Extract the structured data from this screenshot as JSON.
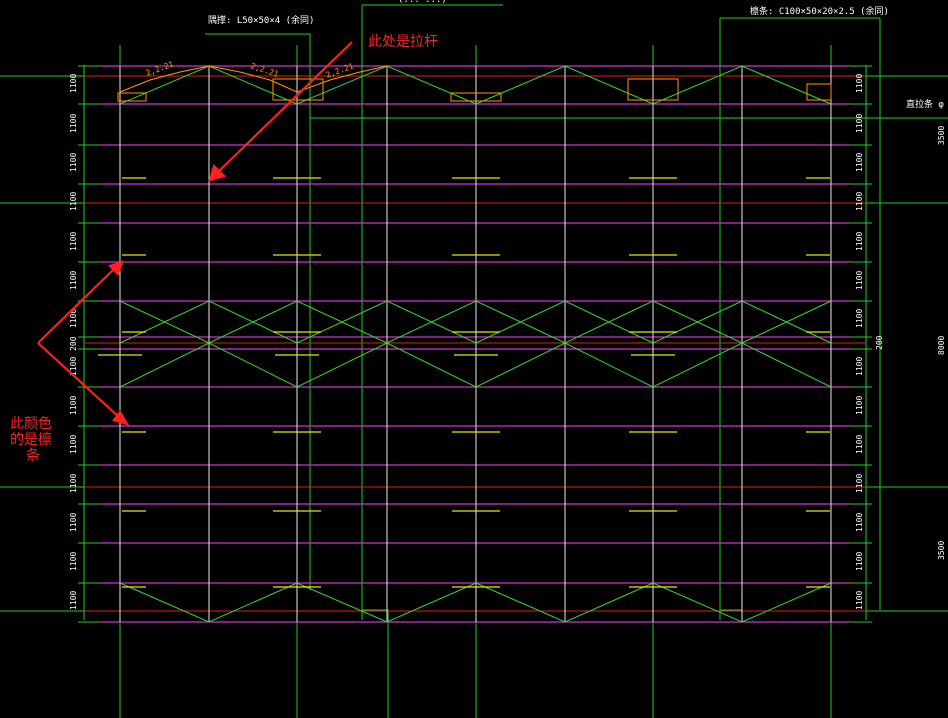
{
  "labels": {
    "brace_spec": "隅撑: L50×50×4 (余同)",
    "purlin_spec": "檩条: C100×50×20×2.5 (余同)",
    "top_center_fragment": "(... ...)",
    "right_partial": "直拉条 φ",
    "right_dim_top": "3500",
    "right_dim_mid": "8000",
    "right_dim_bottom": "3500",
    "mid_tick_label": "200",
    "annotation_tie_rod": "此处是拉杆",
    "annotation_purlin": [
      "此颜色",
      "的是檩",
      "条"
    ]
  },
  "dimensions": {
    "spacing_label": "1100",
    "left_column": [
      "1100",
      "1100",
      "1100",
      "1100",
      "1100",
      "1100",
      "1100",
      "200",
      "1100",
      "1100",
      "1100",
      "1100",
      "1100",
      "1100",
      "1100",
      "1100"
    ],
    "right_column": [
      "1100",
      "1100",
      "1100",
      "1100",
      "1100",
      "1100",
      "1100",
      "1100",
      "1100",
      "1100",
      "1100",
      "1100",
      "1100",
      "1100",
      "1100"
    ],
    "slope_labels": [
      "2,2.21",
      "2,2.21",
      "2,2.21"
    ]
  },
  "colors": {
    "background": "#000000",
    "purlin": "#cc33cc",
    "brace": "#33dd33",
    "grid": "#22cc22",
    "axis_red": "#dd2020",
    "tie_rod_white": "#e8e8e8",
    "marker_yellow": "#e6e600",
    "annotation_red": "#ff2020",
    "dim_orange": "#ff9900"
  }
}
